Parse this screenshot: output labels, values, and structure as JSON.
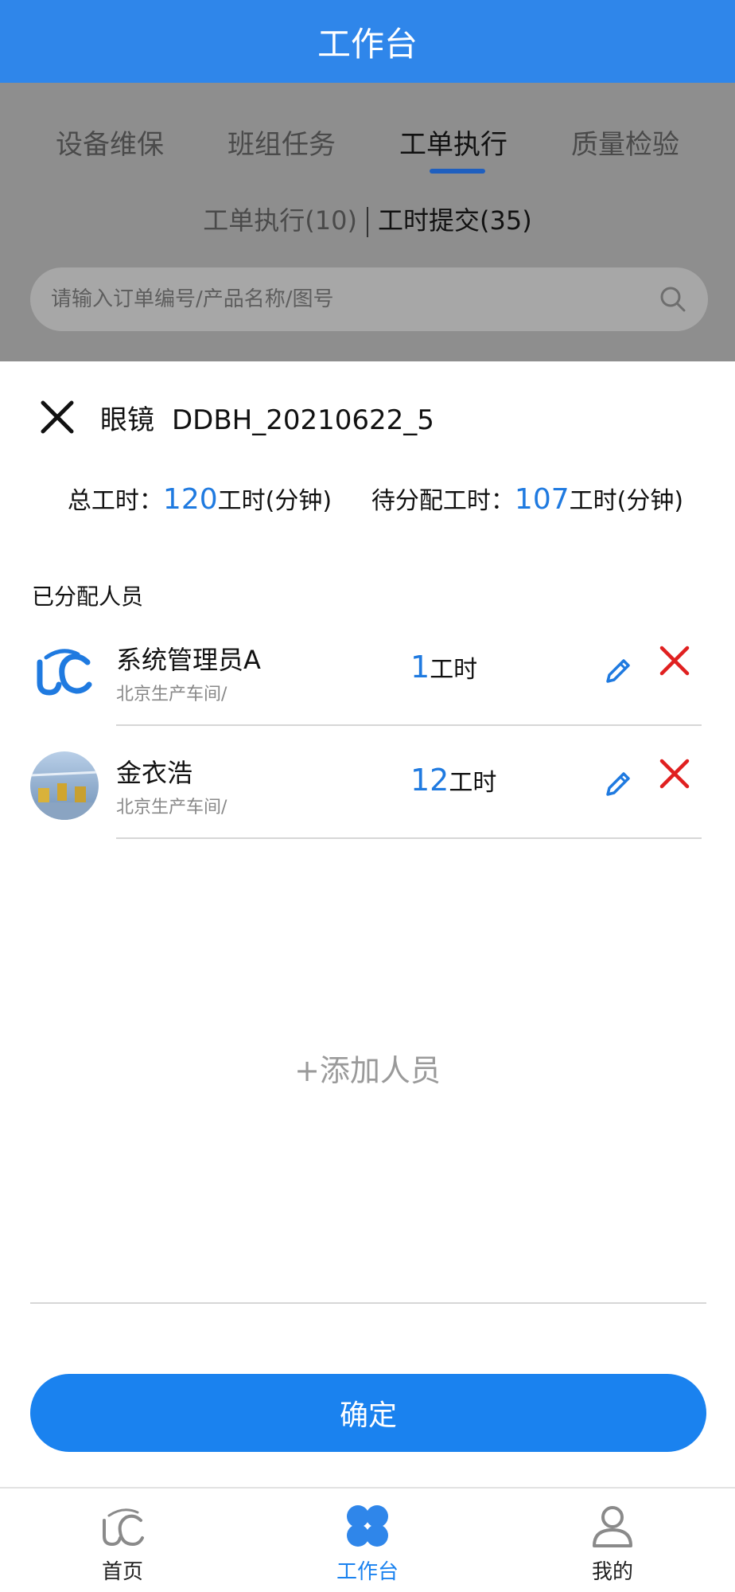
{
  "header": {
    "title": "工作台"
  },
  "tabs": [
    {
      "label": "设备维保"
    },
    {
      "label": "班组任务"
    },
    {
      "label": "工单执行"
    },
    {
      "label": "质量检验"
    }
  ],
  "subtabs": {
    "left": "工单执行(10)",
    "right": "工时提交(35)"
  },
  "search": {
    "placeholder": "请输入订单编号/产品名称/图号"
  },
  "sheet": {
    "product": "眼镜",
    "order": "DDBH_20210622_5",
    "total_label": "总工时：",
    "total_value": "120",
    "pending_label": "待分配工时：",
    "pending_value": "107",
    "unit": "工时(分钟)",
    "assigned_label": "已分配人员",
    "people": [
      {
        "name": "系统管理员A",
        "dept": "北京生产车间/",
        "hours": "1",
        "hours_unit": "工时"
      },
      {
        "name": "金衣浩",
        "dept": "北京生产车间/",
        "hours": "12",
        "hours_unit": "工时"
      }
    ],
    "add_label": "+添加人员",
    "confirm_label": "确定"
  },
  "tabbar": [
    {
      "label": "首页",
      "icon": "home-logo-icon"
    },
    {
      "label": "工作台",
      "icon": "workbench-icon"
    },
    {
      "label": "我的",
      "icon": "user-icon"
    }
  ],
  "colors": {
    "primary": "#2f86ea",
    "accent_number": "#1f7ae0",
    "danger": "#e02020",
    "button": "#1a82ef"
  }
}
